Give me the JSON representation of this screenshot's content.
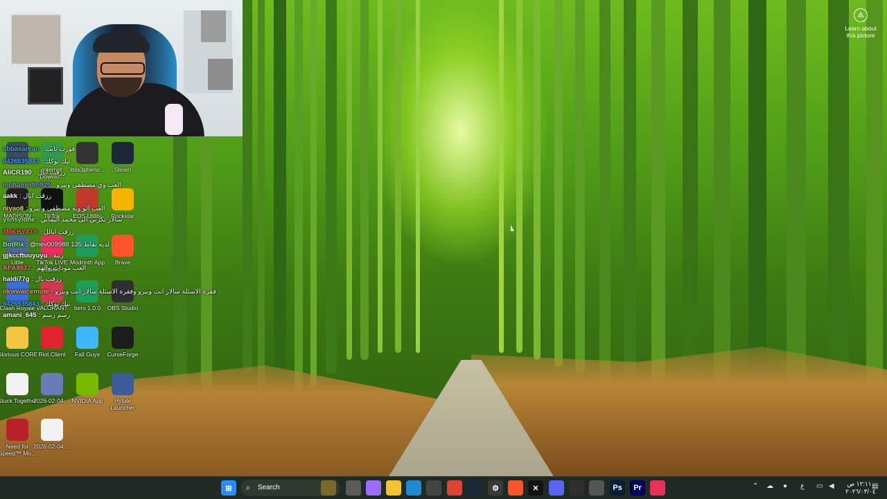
{
  "desktop": {
    "learn_about": "Learn about this picture",
    "learn_icon": "camera-info-icon"
  },
  "chat": [
    {
      "user": "abbasarkan",
      "text": ": فوزت ثابت",
      "color": "#3fa9ff"
    },
    {
      "user": "8426535843",
      "text": ": تيك توكك",
      "color": "#3fa9ff"
    },
    {
      "user": "AliCR190",
      "text": ": رزقت ابال",
      "color": "#ffffff"
    },
    {
      "user": "mohamedm925",
      "text": ": العب وي مصطفى وبيرو",
      "color": "#8f8fff"
    },
    {
      "user": "aakk",
      "text": ": رزقت ابال",
      "color": "#ffffff"
    },
    {
      "user": "niyao8",
      "text": ": العب الو ويه مصطفى و بيرو",
      "color": "#ffd24d"
    },
    {
      "user": "ysnsyidhe",
      "text": ": سالار تكرني الى محمد اليماني",
      "color": "#7fff7f"
    },
    {
      "user": "3MKBYATY",
      "text": ": رزقت ابالل",
      "color": "#ff5c5c"
    },
    {
      "user": "BotRix",
      "text": ": @nev009988 135 لديه نقاط",
      "color": "#7fff7f"
    },
    {
      "user": "gjkccftuuyuyu",
      "text": ": رتبة",
      "color": "#ffffff"
    },
    {
      "user": "APA8537",
      "text": ": العب مودات والهم",
      "color": "#ff7f7f"
    },
    {
      "user": "haldi77g",
      "text": ": رزقت بال",
      "color": "#ffffff"
    },
    {
      "user": "okwwaicemute",
      "text": ": فقرة الاسئلة سالار انت وبيرو وفقرة الاسئلة سالار انت وبيرو",
      "color": "#ff9f40"
    },
    {
      "user": "8426535843",
      "text": ": تيك توكك",
      "color": "#3fa9ff"
    },
    {
      "user": "amani_645",
      "text": ": رسم رسم",
      "color": "#ffffff"
    }
  ],
  "icons": [
    {
      "label": "",
      "icon": "shield-app-icon",
      "color": "#3a4b5c"
    },
    {
      "label": "Internet Downlo...",
      "icon": "download-globe-icon",
      "color": "#2e9c4c"
    },
    {
      "label": "iblis3pheno...",
      "icon": "folder-image-icon",
      "color": "#333333"
    },
    {
      "label": "Steam",
      "icon": "steam-icon",
      "color": "#1b2838"
    },
    {
      "label": "MADISON",
      "icon": "madison-icon",
      "color": "#202020"
    },
    {
      "label": "TikTok",
      "icon": "tiktok-icon",
      "color": "#111111"
    },
    {
      "label": "EOS Utility",
      "icon": "eos-utility-icon",
      "color": "#c0392b"
    },
    {
      "label": "Rockstar",
      "icon": "rockstar-icon",
      "color": "#f4b400"
    },
    {
      "label": "Little",
      "icon": "little-icon",
      "color": "#4a6b8a"
    },
    {
      "label": "TikTok LIVE Studio",
      "icon": "tiktok-live-icon",
      "color": "#e8305a"
    },
    {
      "label": "Modrinth App",
      "icon": "modrinth-icon",
      "color": "#1e9e5a"
    },
    {
      "label": "Brave",
      "icon": "brave-icon",
      "color": "#fb542b"
    },
    {
      "label": "Clash Royale",
      "icon": "clash-royale-icon",
      "color": "#3b6fd1"
    },
    {
      "label": "VALORANT",
      "icon": "valorant-icon",
      "color": "#d2394e"
    },
    {
      "label": "bero 1.0.0",
      "icon": "bero-icon",
      "color": "#1e9e5a"
    },
    {
      "label": "OBS Studio",
      "icon": "obs-icon",
      "color": "#302e31"
    },
    {
      "label": "Glorious CORE",
      "icon": "glorious-icon",
      "color": "#f4c542"
    },
    {
      "label": "Riot Client",
      "icon": "riot-client-icon",
      "color": "#e0242f"
    },
    {
      "label": "Fall Guys",
      "icon": "fall-guys-icon",
      "color": "#3fb7ff"
    },
    {
      "label": "CurseForge",
      "icon": "curseforge-icon",
      "color": "#1c1c1c"
    },
    {
      "label": "Stuck Together",
      "icon": "file-icon",
      "color": "#f2f2f2"
    },
    {
      "label": "2026-02-04-...",
      "icon": "video-file-icon",
      "color": "#6b7bb8"
    },
    {
      "label": "NVIDIA App",
      "icon": "nvidia-icon",
      "color": "#76b900"
    },
    {
      "label": "Hytale Launcher",
      "icon": "hytale-icon",
      "color": "#3d5a99"
    },
    {
      "label": "Need for Speed™ Mo...",
      "icon": "nfs-icon",
      "color": "#b8202a"
    },
    {
      "label": "2026-02-04-...",
      "icon": "file-icon",
      "color": "#f2f2f2"
    }
  ],
  "taskbar": {
    "search_label": "Search",
    "apps": [
      {
        "name": "start-icon",
        "glyph": "⊞",
        "color": "#2a8cff"
      },
      {
        "name": "widgets-icon",
        "glyph": "",
        "color": "#7a6a2a"
      },
      {
        "name": "task-view-icon",
        "glyph": "",
        "color": "#5a5a5a"
      },
      {
        "name": "copilot-icon",
        "glyph": "",
        "color": "#9b6bff"
      },
      {
        "name": "file-explorer-icon",
        "glyph": "",
        "color": "#f2c230"
      },
      {
        "name": "edge-icon",
        "glyph": "",
        "color": "#1f8ad2"
      },
      {
        "name": "store-icon",
        "glyph": "",
        "color": "#444444"
      },
      {
        "name": "chrome-icon",
        "glyph": "",
        "color": "#db4437"
      },
      {
        "name": "steam-icon",
        "glyph": "",
        "color": "#1b2838"
      },
      {
        "name": "settings-icon",
        "glyph": "⚙",
        "color": "#3a3a3a"
      },
      {
        "name": "brave-icon",
        "glyph": "",
        "color": "#fb542b"
      },
      {
        "name": "capcut-icon",
        "glyph": "✕",
        "color": "#111111"
      },
      {
        "name": "discord-icon",
        "glyph": "",
        "color": "#5865f2"
      },
      {
        "name": "obs-icon",
        "glyph": "",
        "color": "#302e31"
      },
      {
        "name": "snipping-icon",
        "glyph": "",
        "color": "#555555"
      },
      {
        "name": "photoshop-icon",
        "glyph": "Ps",
        "color": "#001e36"
      },
      {
        "name": "premiere-icon",
        "glyph": "Pr",
        "color": "#00005b"
      },
      {
        "name": "tiktok-icon",
        "glyph": "",
        "color": "#e8305a"
      }
    ],
    "lang": "ع",
    "clock_time": "١٢:١١ ص",
    "clock_date": "٢٠٢٦/٠٣/٠٤"
  }
}
